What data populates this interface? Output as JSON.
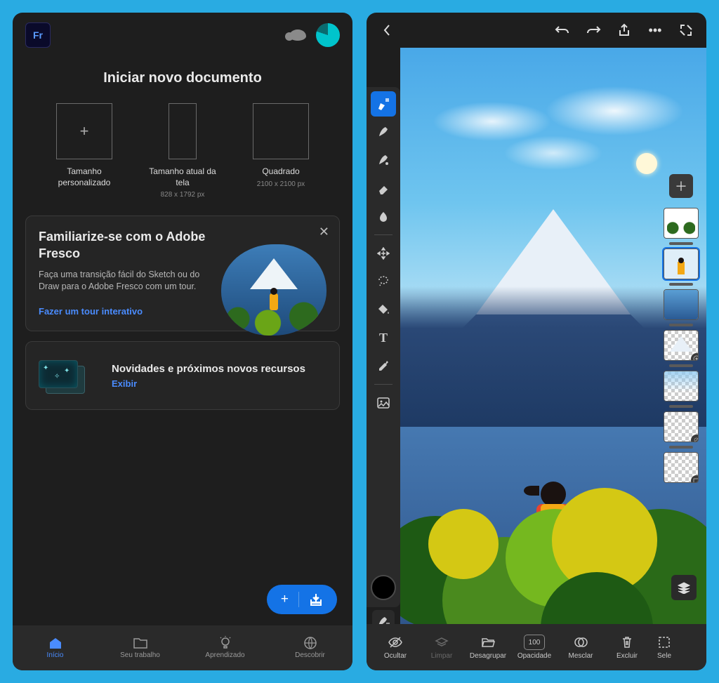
{
  "app": {
    "logo_text": "Fr"
  },
  "home": {
    "title": "Iniciar novo documento",
    "presets": [
      {
        "label": "Tamanho personalizado",
        "dim": ""
      },
      {
        "label": "Tamanho atual da tela",
        "dim": "828 x 1792 px"
      },
      {
        "label": "Quadrado",
        "dim": "2100 x 2100 px"
      }
    ],
    "promo": {
      "heading": "Familiarize-se com o Adobe Fresco",
      "body": "Faça uma transição fácil do Sketch ou do Draw para o Adobe Fresco com um tour.",
      "cta": "Fazer um tour interativo"
    },
    "news": {
      "heading": "Novidades e próximos novos recursos",
      "cta": "Exibir"
    },
    "tabs": [
      {
        "label": "Início"
      },
      {
        "label": "Seu trabalho"
      },
      {
        "label": "Aprendizado"
      },
      {
        "label": "Descobrir"
      }
    ]
  },
  "editor": {
    "bottom": [
      {
        "label": "Ocultar"
      },
      {
        "label": "Limpar"
      },
      {
        "label": "Desagrupar"
      },
      {
        "label": "Opacidade",
        "value": "100"
      },
      {
        "label": "Mesclar"
      },
      {
        "label": "Excluir"
      },
      {
        "label": "Sele"
      }
    ],
    "tools": [
      "pixel-brush",
      "vector-brush",
      "live-brush",
      "eraser",
      "smudge",
      "move",
      "lasso",
      "fill",
      "text",
      "eyedropper",
      "image-place"
    ]
  }
}
